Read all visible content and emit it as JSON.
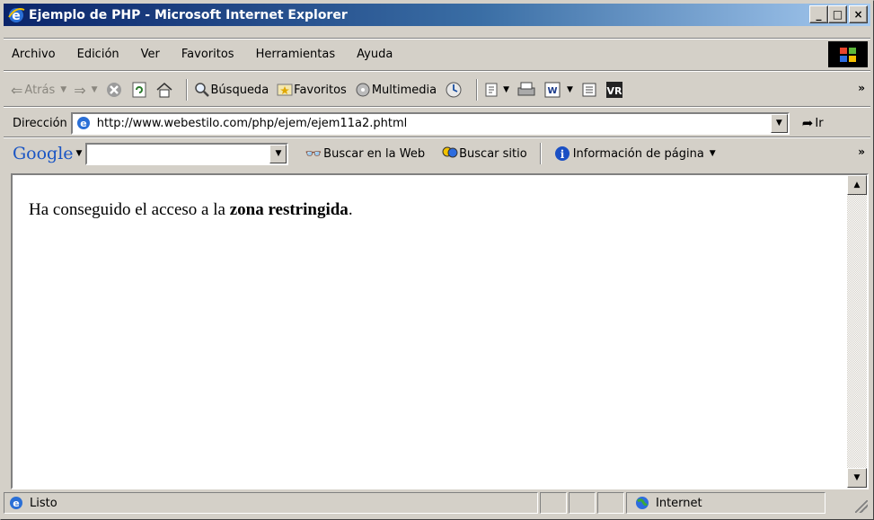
{
  "window": {
    "title": "Ejemplo de PHP - Microsoft Internet Explorer",
    "controls": {
      "minimize": "_",
      "maximize": "□",
      "close": "×"
    }
  },
  "menu": {
    "items": [
      "Archivo",
      "Edición",
      "Ver",
      "Favoritos",
      "Herramientas",
      "Ayuda"
    ]
  },
  "toolbar": {
    "back_label": "Atrás",
    "search_label": "Búsqueda",
    "favorites_label": "Favoritos",
    "media_label": "Multimedia"
  },
  "address": {
    "label": "Dirección",
    "url": "http://www.webestilo.com/php/ejem/ejem11a2.phtml",
    "go_label": "Ir"
  },
  "google_bar": {
    "logo": "Google",
    "search_value": "",
    "search_web_label": "Buscar en la Web",
    "search_site_label": "Buscar sitio",
    "page_info_label": "Información de página"
  },
  "page": {
    "text_before": "Ha conseguido el acceso a la ",
    "text_bold": "zona restringida",
    "text_after": "."
  },
  "status": {
    "text": "Listo",
    "zone": "Internet"
  },
  "colors": {
    "titlebar_start": "#0a246a",
    "titlebar_end": "#a6caf0",
    "chrome": "#d4d0c8"
  }
}
